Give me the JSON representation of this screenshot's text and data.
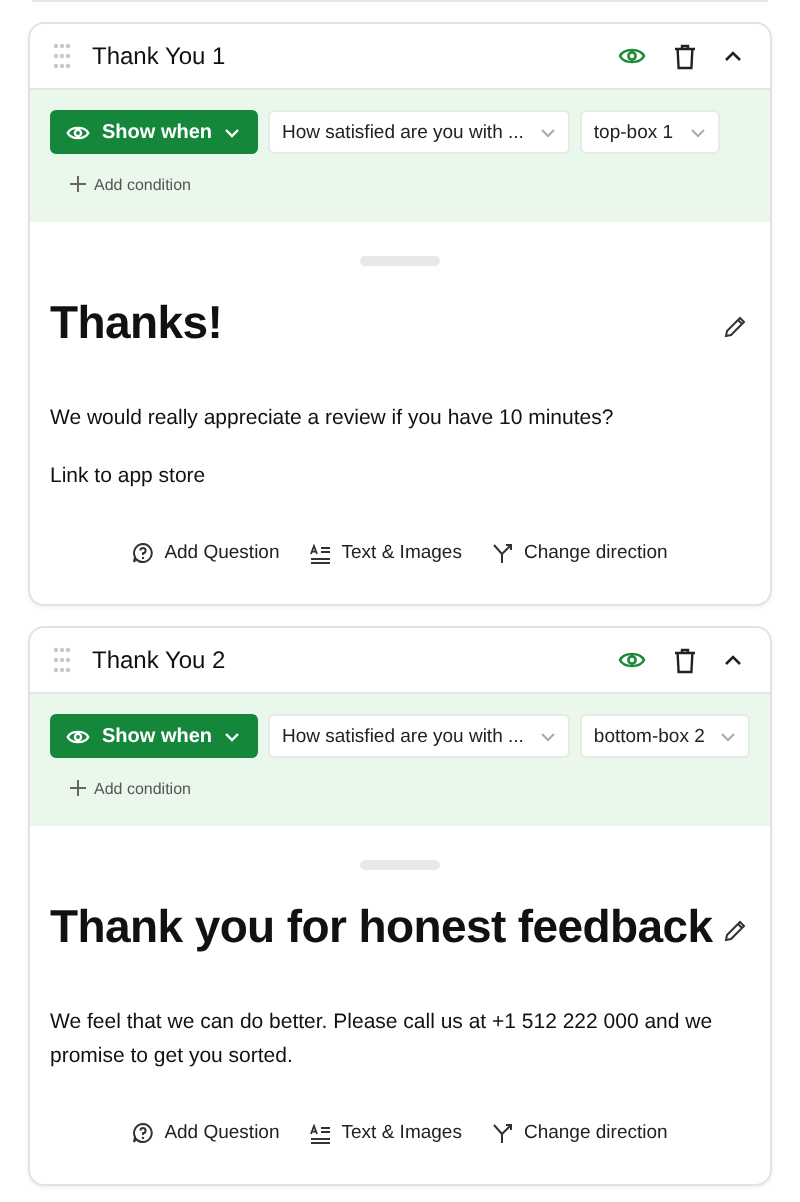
{
  "cards": [
    {
      "title": "Thank You 1",
      "visible": true,
      "condition": {
        "mode": "Show when",
        "question": "How satisfied are you with ...",
        "answer": "top-box 1",
        "add": "Add condition"
      },
      "heading": "Thanks!",
      "paragraphs": [
        "We would really appreciate a review if you have 10 minutes?",
        "Link to app store"
      ],
      "actions": [
        {
          "kind": "question",
          "label": "Add Question"
        },
        {
          "kind": "text",
          "label": "Text & Images"
        },
        {
          "kind": "direction",
          "label": "Change direction"
        }
      ]
    },
    {
      "title": "Thank You 2",
      "visible": true,
      "condition": {
        "mode": "Show when",
        "question": "How satisfied are you with ...",
        "answer": "bottom-box 2",
        "add": "Add condition"
      },
      "heading": "Thank you for honest feedback",
      "paragraphs": [
        "We feel that we can do better. Please call us at +1 512 222 000 and we promise to get you sorted."
      ],
      "actions": [
        {
          "kind": "question",
          "label": "Add Question"
        },
        {
          "kind": "text",
          "label": "Text & Images"
        },
        {
          "kind": "direction",
          "label": "Change direction"
        }
      ]
    }
  ]
}
